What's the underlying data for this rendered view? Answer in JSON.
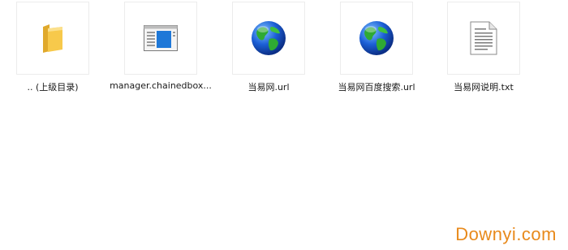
{
  "files": [
    {
      "name": ".. (上级目录)",
      "icon": "folder-icon"
    },
    {
      "name": "manager.chainedbox...",
      "icon": "window-app-icon"
    },
    {
      "name": "当易网.url",
      "icon": "globe-icon"
    },
    {
      "name": "当易网百度搜索.url",
      "icon": "globe-icon"
    },
    {
      "name": "当易网说明.txt",
      "icon": "text-document-icon"
    }
  ],
  "watermark": "Downyi.com",
  "colors": {
    "folder": "#f5c445",
    "window_accent": "#1e78d8",
    "globe_ocean": "#1c5fd6",
    "globe_land": "#2faa33",
    "watermark": "#e88a1c"
  }
}
